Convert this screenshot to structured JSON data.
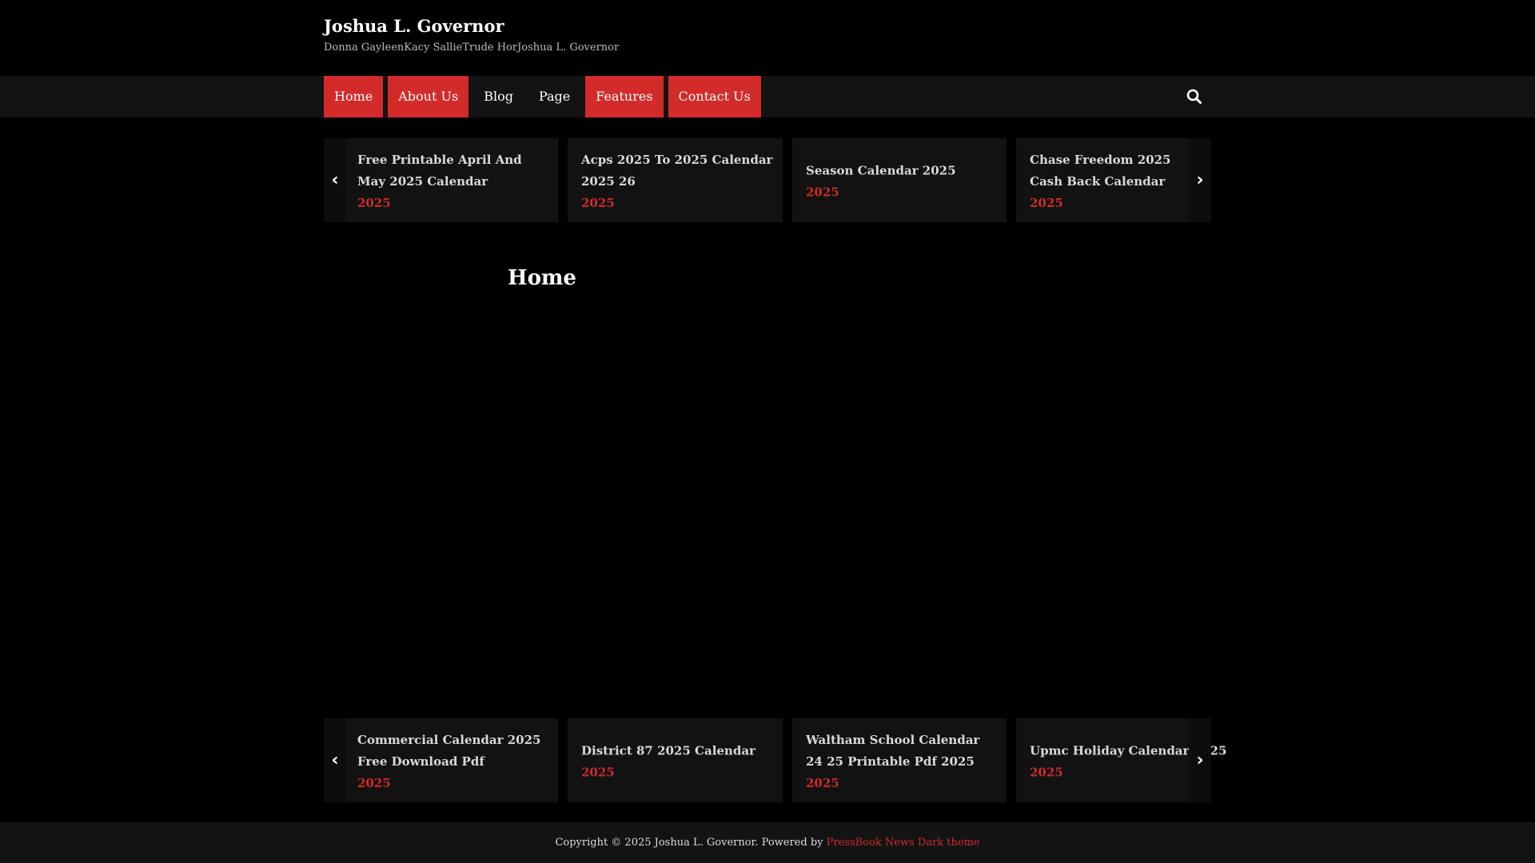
{
  "header": {
    "site_title": "Joshua L. Governor",
    "tagline": "Donna GayleenKacy SallieTrude HorJoshua L. Governor"
  },
  "nav": {
    "items": [
      {
        "label": "Home",
        "active": true
      },
      {
        "label": "About Us",
        "active": true
      },
      {
        "label": "Blog",
        "active": false
      },
      {
        "label": "Page",
        "active": false
      },
      {
        "label": "Features",
        "active": true
      },
      {
        "label": "Contact Us",
        "active": true
      }
    ],
    "search_icon": "search-icon"
  },
  "ticker_top": {
    "cards": [
      {
        "title": "Free Printable April And May 2025 Calendar",
        "meta": "2025"
      },
      {
        "title": "Acps 2025 To 2025 Calendar 2025 26",
        "meta": "2025"
      },
      {
        "title": "Season Calendar 2025",
        "meta": "2025"
      },
      {
        "title": "Chase Freedom 2025 Cash Back Calendar",
        "meta": "2025"
      }
    ],
    "prev_icon": "chevron-left-icon",
    "next_icon": "chevron-right-icon"
  },
  "main": {
    "heading": "Home"
  },
  "ticker_bottom": {
    "cards": [
      {
        "title": "Commercial Calendar 2025 Free Download Pdf",
        "meta": "2025"
      },
      {
        "title": "District 87 2025 Calendar",
        "meta": "2025"
      },
      {
        "title": "Waltham School Calendar 24 25 Printable Pdf 2025",
        "meta": "2025"
      },
      {
        "title": "Upmc Holiday Calendar 2025",
        "meta": "2025"
      }
    ]
  },
  "footer": {
    "copyright": "Copyright © 2025 Joshua L. Governor. Powered by ",
    "link_text": "PressBook News Dark theme"
  },
  "colors": {
    "accent": "#d32a2a",
    "background": "#000000",
    "nav_background": "#131313",
    "card_background": "#121212"
  }
}
